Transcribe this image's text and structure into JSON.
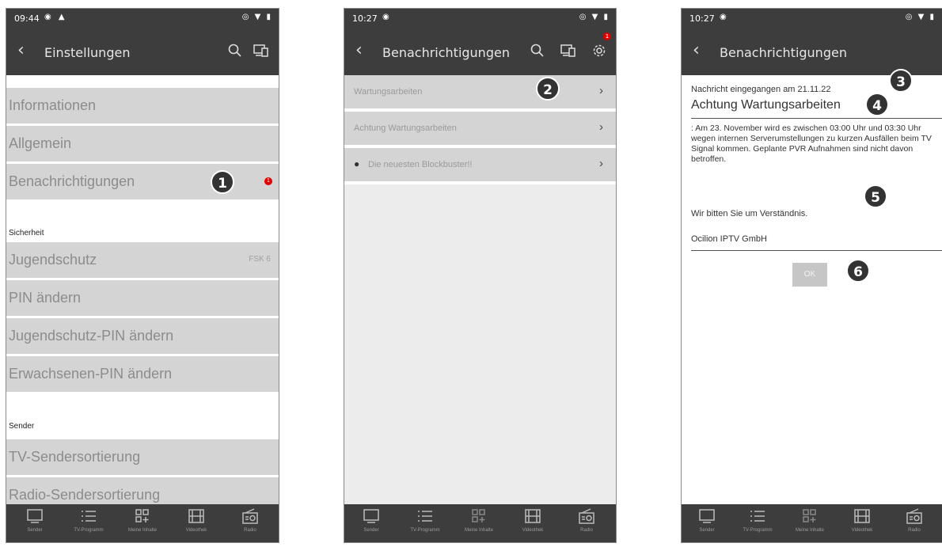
{
  "screen1": {
    "status_time": "09:44",
    "title": "Einstellungen",
    "rows": [
      {
        "label": "Informationen"
      },
      {
        "label": "Allgemein"
      },
      {
        "label": "Benachrichtigungen"
      }
    ],
    "section_security": "Sicherheit",
    "security_rows": [
      {
        "label": "Jugendschutz",
        "value": "FSK 6"
      },
      {
        "label": "PIN ändern"
      },
      {
        "label": "Jugendschutz-PIN ändern"
      },
      {
        "label": "Erwachsenen-PIN ändern"
      }
    ],
    "section_sender": "Sender",
    "sender_rows": [
      {
        "label": "TV-Sendersortierung"
      },
      {
        "label": "Radio-Sendersortierung"
      }
    ],
    "badge": "1",
    "notification_count": "1"
  },
  "screen2": {
    "status_time": "10:27",
    "title": "Benachrichtigungen",
    "rows": [
      {
        "label": "Wartungsarbeiten"
      },
      {
        "label": "Achtung Wartungsarbeiten"
      },
      {
        "label": "Die neuesten Blockbuster!!"
      }
    ],
    "badge": "2",
    "settings_count": "1"
  },
  "screen3": {
    "status_time": "10:27",
    "title": "Benachrichtigungen",
    "received": "Nachricht eingegangen am 21.11.22",
    "subject": "Achtung Wartungsarbeiten",
    "body": ": Am 23. November wird es zwischen 03:00 Uhr und 03:30 Uhr wegen internen Serverumstellungen zu kurzen Ausfällen beim TV Signal kommen. Geplante PVR Aufnahmen sind nicht davon betroffen.",
    "closing": "Wir bitten Sie um Verständnis.",
    "sender": "Ocilion IPTV GmbH",
    "ok_label": "OK",
    "badges": [
      "3",
      "4",
      "5",
      "6"
    ]
  },
  "nav": [
    {
      "label": "Sender",
      "icon": "tv-icon"
    },
    {
      "label": "TV-Programm",
      "icon": "list-icon"
    },
    {
      "label": "Meine Inhalte",
      "icon": "grid-plus-icon"
    },
    {
      "label": "Videothek",
      "icon": "film-icon"
    },
    {
      "label": "Radio",
      "icon": "radio-icon"
    }
  ]
}
